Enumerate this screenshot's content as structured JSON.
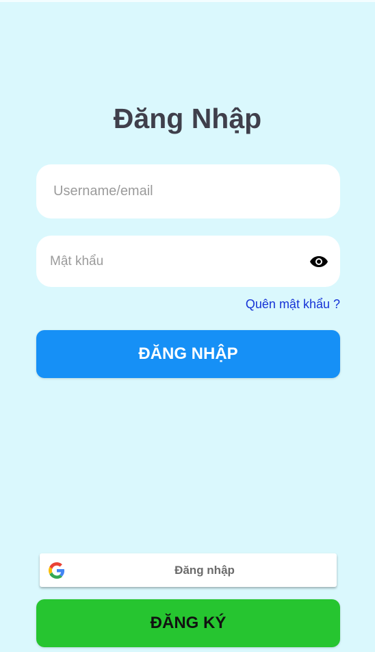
{
  "title": "Đăng Nhập",
  "username": {
    "placeholder": "Username/email",
    "value": ""
  },
  "password": {
    "placeholder": "Mật khẩu",
    "value": "",
    "toggle_icon": "eye-icon"
  },
  "forgot_link": "Quên mật khẩu ?",
  "login_button": "ĐĂNG NHẬP",
  "google_button": {
    "label": "Đăng nhập",
    "icon": "google-icon"
  },
  "register_button": "ĐĂNG KÝ",
  "colors": {
    "background": "#daf8fd",
    "login_button": "#1690f6",
    "register_button": "#26c530",
    "link": "#1633d6",
    "title": "#3f3f4b"
  }
}
